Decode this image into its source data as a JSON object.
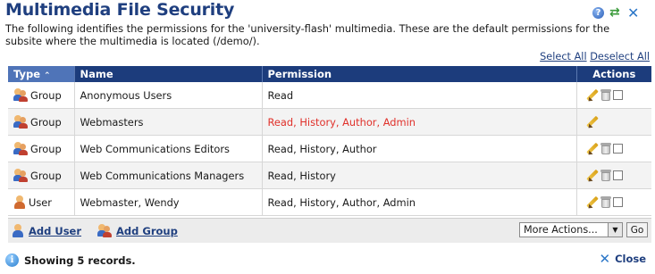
{
  "header": {
    "title": "Multimedia File Security",
    "description": "The following identifies the permissions for the 'university-flash' multimedia. These are the default permissions for the subsite where the multimedia is located (/demo/).",
    "icons": [
      "help-icon",
      "refresh-icon",
      "close-icon"
    ]
  },
  "select_links": {
    "select_all": "Select All",
    "deselect_all": "Deselect All"
  },
  "table": {
    "columns": {
      "type": "Type",
      "type_sort": "⌃",
      "name": "Name",
      "permission": "Permission",
      "actions": "Actions"
    },
    "rows": [
      {
        "type": "Group",
        "name": "Anonymous Users",
        "permission": "Read",
        "has_delete": true
      },
      {
        "type": "Group",
        "name": "Webmasters",
        "permission": "Read, History, Author, Admin",
        "highlight": true,
        "has_delete": false
      },
      {
        "type": "Group",
        "name": "Web Communications Editors",
        "permission": "Read, History, Author",
        "has_delete": true
      },
      {
        "type": "Group",
        "name": "Web Communications Managers",
        "permission": "Read, History",
        "has_delete": true
      },
      {
        "type": "User",
        "name": "Webmaster, Wendy",
        "permission": "Read, History, Author, Admin",
        "has_delete": true
      }
    ]
  },
  "footer": {
    "add_user": "Add User",
    "add_group": "Add Group",
    "more_actions": "More Actions...",
    "go": "Go"
  },
  "status": {
    "text": "Showing 5 records.",
    "close": "Close"
  },
  "colors": {
    "header_bg": "#1c3c7c",
    "title": "#1f3f7f",
    "admin_red": "#e0302a"
  }
}
